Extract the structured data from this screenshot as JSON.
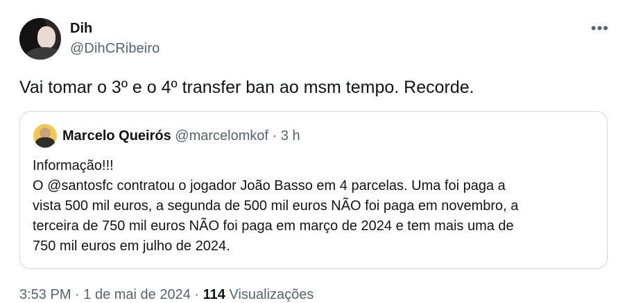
{
  "author": {
    "display_name": "Dih",
    "handle": "@DihCRibeiro",
    "more_icon": "more-horizontal-icon"
  },
  "tweet": {
    "text": "Vai tomar o 3º e o 4º transfer ban ao msm tempo. Recorde."
  },
  "quoted": {
    "display_name": "Marcelo Queirós",
    "handle": "@marcelomkof",
    "separator": "·",
    "time": "3 h",
    "lines": [
      "Informação!!!",
      "O @santosfc contratou o jogador João Basso em 4 parcelas. Uma foi paga a",
      "vista 500 mil euros, a segunda de 500 mil euros NÃO foi paga em novembro, a",
      "terceira de 750 mil euros NÃO foi paga em março de 2024 e tem mais uma de",
      "750 mil euros em julho de 2024."
    ]
  },
  "footer": {
    "time": "3:53 PM",
    "dot": "·",
    "date": "1 de mai de 2024",
    "dot2": "·",
    "views_count": "114",
    "views_label": "Visualizações"
  },
  "colors": {
    "text": "#0f1419",
    "secondary": "#536471",
    "border": "#cfd9de"
  }
}
